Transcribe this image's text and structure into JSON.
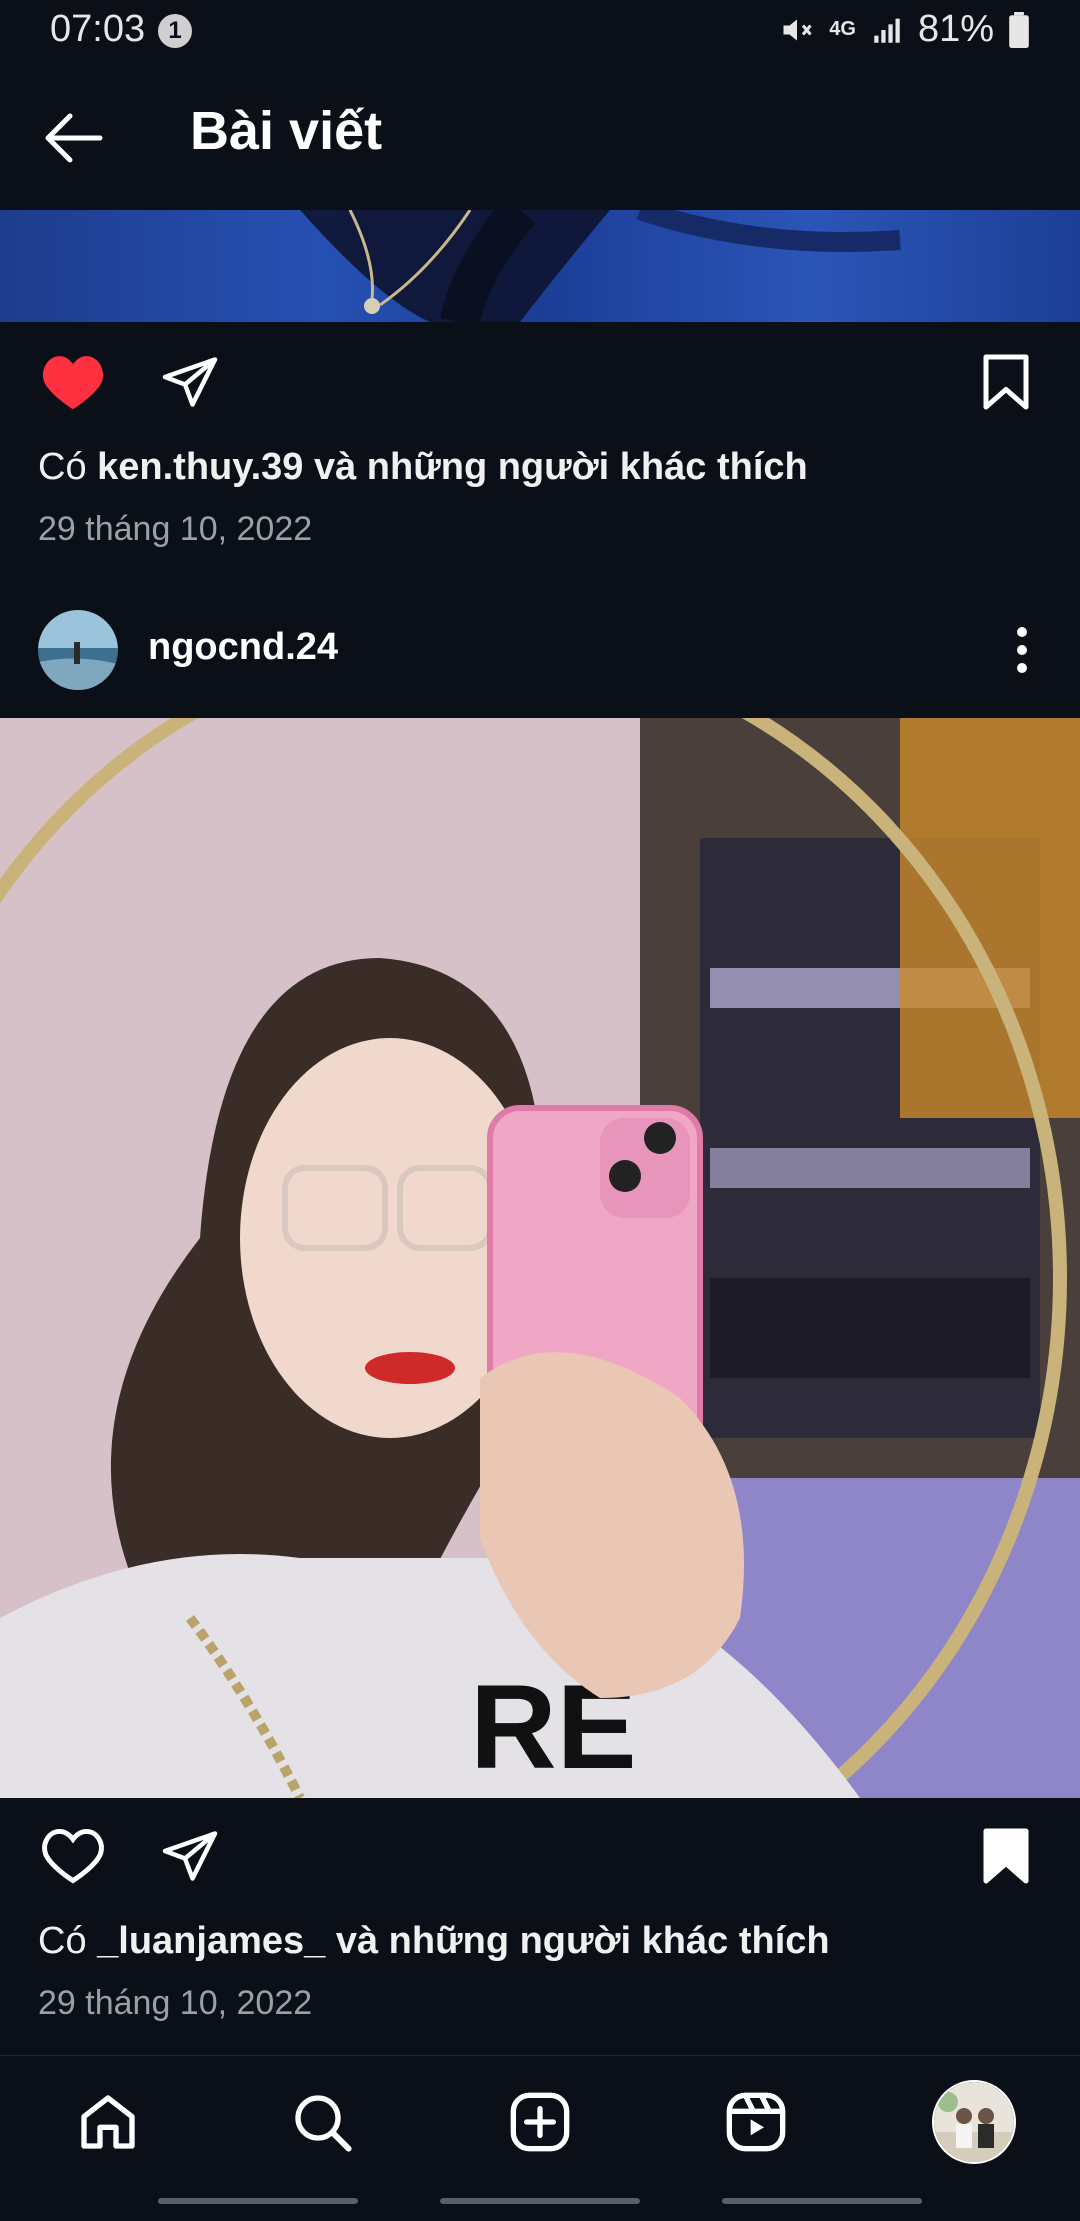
{
  "status_bar": {
    "time": "07:03",
    "notification_count": "1",
    "network": "4G",
    "battery": "81%"
  },
  "header": {
    "title": "Bài viết"
  },
  "post1": {
    "likes_prefix": "Có",
    "liked_by": "ken.thuy.39",
    "likes_suffix": "và những người khác thích",
    "date": "29 tháng 10, 2022",
    "liked": true,
    "saved": false
  },
  "post2": {
    "username": "ngocnd.24",
    "likes_prefix": "Có",
    "liked_by": "_luanjames_",
    "likes_suffix": "và những người khác thích",
    "date": "29 tháng 10, 2022",
    "liked": false,
    "saved": true
  },
  "colors": {
    "background": "#0b0f17",
    "like_red": "#ff3040",
    "text": "#f5f5f5",
    "muted": "#9aa0a8"
  },
  "icons": {
    "nav": [
      "home-icon",
      "search-icon",
      "create-icon",
      "reels-icon",
      "profile-avatar"
    ]
  }
}
